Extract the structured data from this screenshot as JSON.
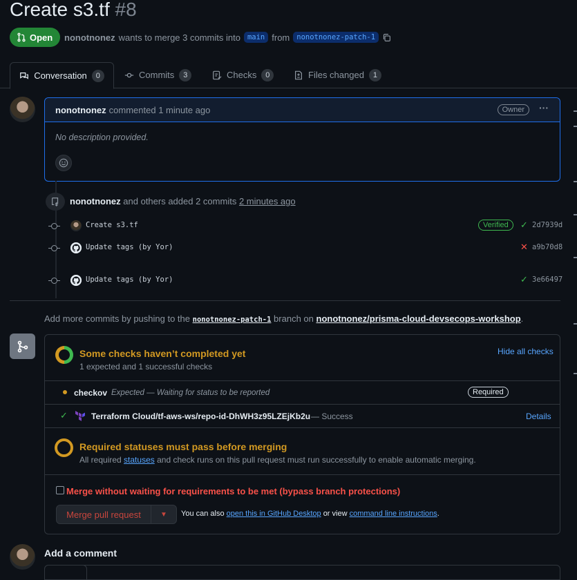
{
  "header": {
    "title": "Create s3.tf",
    "number": "#8",
    "state": "Open",
    "author": "nonotnonez",
    "merge_text": "wants to merge 3 commits into",
    "base_branch": "main",
    "from_text": "from",
    "head_branch": "nonotnonez-patch-1"
  },
  "tabs": [
    {
      "label": "Conversation",
      "count": "0"
    },
    {
      "label": "Commits",
      "count": "3"
    },
    {
      "label": "Checks",
      "count": "0"
    },
    {
      "label": "Files changed",
      "count": "1"
    }
  ],
  "comment": {
    "author": "nonotnonez",
    "action": "commented",
    "time": "1 minute ago",
    "role": "Owner",
    "body": "No description provided."
  },
  "commits_event": {
    "author": "nonotnonez",
    "text": "and others added 2 commits",
    "time": "2 minutes ago",
    "commits": [
      {
        "message": "Create s3.tf",
        "badge": "Verified",
        "status": "success",
        "sha": "2d7939d"
      },
      {
        "message": "Update tags (by Yor)",
        "status": "failure",
        "sha": "a9b70d8"
      },
      {
        "message": "Update tags (by Yor)",
        "status": "success",
        "sha": "3e66497"
      }
    ]
  },
  "push_note": {
    "prefix": "Add more commits by pushing to the",
    "branch": "nonotnonez-patch-1",
    "middle": "branch on",
    "repo": "nonotnonez/prisma-cloud-devsecops-workshop"
  },
  "checks": {
    "title": "Some checks haven’t completed yet",
    "subtitle": "1 expected and 1 successful checks",
    "hide_link": "Hide all checks",
    "items": [
      {
        "name": "checkov",
        "desc": "Expected — Waiting for status to be reported",
        "badge": "Required"
      },
      {
        "name": "Terraform Cloud/tf-aws-ws/repo-id-DhWH3z95LZEjKb2u",
        "desc": "— Success",
        "link": "Details"
      }
    ]
  },
  "required": {
    "title": "Required statuses must pass before merging",
    "text_before": "All required",
    "link": "statuses",
    "text_after": "and check runs on this pull request must run successfully to enable automatic merging."
  },
  "bypass": {
    "label": "Merge without waiting for requirements to be met (bypass branch protections)",
    "checked": false
  },
  "merge": {
    "button": "Merge pull request",
    "also_text": "You can also",
    "desktop_link": "open this in GitHub Desktop",
    "or_text": "or view",
    "cli_link": "command line instructions",
    "period": "."
  },
  "add_comment": {
    "title": "Add a comment"
  },
  "colors": {
    "accent": "#1f6feb",
    "open": "#238636",
    "warning": "#d29922",
    "success": "#3fb950",
    "danger": "#f85149"
  }
}
